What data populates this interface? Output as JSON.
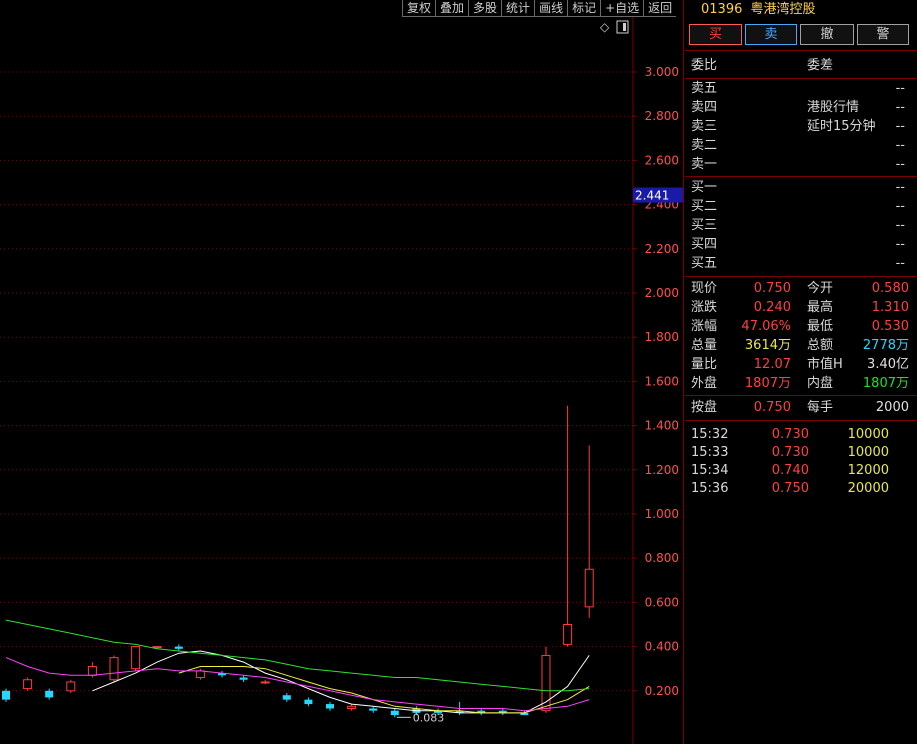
{
  "toolbar": [
    "复权",
    "叠加",
    "多股",
    "统计",
    "画线",
    "标记",
    "+自选",
    "返回"
  ],
  "chart": {
    "price_labels": [
      "3.000",
      "2.800",
      "2.600",
      "2.400",
      "2.200",
      "2.000",
      "1.800",
      "1.600",
      "1.400",
      "1.200",
      "1.000",
      "0.800",
      "0.600",
      "0.400",
      "0.200"
    ],
    "current_price_tag": "2.441",
    "low_marker": "0.083",
    "colors": {
      "grid": "#7a0000",
      "up": "#ff3b3b",
      "down": "#22d8ff",
      "ma_white": "#ffffff",
      "ma_yellow": "#f0f040",
      "ma_magenta": "#ff40ff",
      "ma_green": "#30e030"
    }
  },
  "chart_data": {
    "type": "candlestick",
    "ylim": [
      0.0,
      3.15
    ],
    "candles": [
      {
        "o": 0.2,
        "c": 0.16,
        "h": 0.21,
        "l": 0.15
      },
      {
        "o": 0.21,
        "c": 0.25,
        "h": 0.26,
        "l": 0.2
      },
      {
        "o": 0.2,
        "c": 0.17,
        "h": 0.21,
        "l": 0.16
      },
      {
        "o": 0.2,
        "c": 0.24,
        "h": 0.25,
        "l": 0.19
      },
      {
        "o": 0.27,
        "c": 0.31,
        "h": 0.33,
        "l": 0.26
      },
      {
        "o": 0.25,
        "c": 0.35,
        "h": 0.36,
        "l": 0.24
      },
      {
        "o": 0.3,
        "c": 0.4,
        "h": 0.4,
        "l": 0.29
      },
      {
        "o": 0.4,
        "c": 0.4,
        "h": 0.4,
        "l": 0.39
      },
      {
        "o": 0.4,
        "c": 0.39,
        "h": 0.41,
        "l": 0.38
      },
      {
        "o": 0.26,
        "c": 0.29,
        "h": 0.3,
        "l": 0.25
      },
      {
        "o": 0.28,
        "c": 0.27,
        "h": 0.29,
        "l": 0.26
      },
      {
        "o": 0.26,
        "c": 0.25,
        "h": 0.27,
        "l": 0.24
      },
      {
        "o": 0.24,
        "c": 0.24,
        "h": 0.25,
        "l": 0.23
      },
      {
        "o": 0.18,
        "c": 0.16,
        "h": 0.19,
        "l": 0.15
      },
      {
        "o": 0.16,
        "c": 0.14,
        "h": 0.17,
        "l": 0.13
      },
      {
        "o": 0.14,
        "c": 0.12,
        "h": 0.15,
        "l": 0.11
      },
      {
        "o": 0.12,
        "c": 0.13,
        "h": 0.14,
        "l": 0.11
      },
      {
        "o": 0.12,
        "c": 0.11,
        "h": 0.13,
        "l": 0.1
      },
      {
        "o": 0.11,
        "c": 0.09,
        "h": 0.12,
        "l": 0.08
      },
      {
        "o": 0.12,
        "c": 0.1,
        "h": 0.13,
        "l": 0.09
      },
      {
        "o": 0.11,
        "c": 0.1,
        "h": 0.12,
        "l": 0.09
      },
      {
        "o": 0.11,
        "c": 0.1,
        "h": 0.15,
        "l": 0.09
      },
      {
        "o": 0.11,
        "c": 0.1,
        "h": 0.12,
        "l": 0.09
      },
      {
        "o": 0.11,
        "c": 0.1,
        "h": 0.12,
        "l": 0.09
      },
      {
        "o": 0.1,
        "c": 0.09,
        "h": 0.11,
        "l": 0.09
      },
      {
        "o": 0.11,
        "c": 0.36,
        "h": 0.4,
        "l": 0.1
      },
      {
        "o": 0.41,
        "c": 0.5,
        "h": 1.49,
        "l": 0.4
      },
      {
        "o": 0.58,
        "c": 0.75,
        "h": 1.31,
        "l": 0.53
      }
    ],
    "series": [
      {
        "color": "#ffffff",
        "values": [
          null,
          null,
          null,
          null,
          0.2,
          0.24,
          0.28,
          0.33,
          0.37,
          0.38,
          0.36,
          0.33,
          0.28,
          0.25,
          0.21,
          0.17,
          0.14,
          0.13,
          0.12,
          0.11,
          0.11,
          0.1,
          0.1,
          0.1,
          0.1,
          0.15,
          0.22,
          0.36
        ]
      },
      {
        "color": "#f0f040",
        "values": [
          null,
          null,
          null,
          null,
          null,
          null,
          null,
          null,
          0.28,
          0.31,
          0.31,
          0.31,
          0.3,
          0.27,
          0.24,
          0.21,
          0.19,
          0.16,
          0.13,
          0.12,
          0.11,
          0.11,
          0.1,
          0.1,
          0.1,
          0.13,
          0.16,
          0.22
        ]
      },
      {
        "color": "#ff40ff",
        "values": [
          0.35,
          0.31,
          0.28,
          0.27,
          0.27,
          0.28,
          0.29,
          0.3,
          0.29,
          0.29,
          0.28,
          0.27,
          0.26,
          0.24,
          0.22,
          0.2,
          0.18,
          0.16,
          0.15,
          0.14,
          0.13,
          0.12,
          0.12,
          0.12,
          0.11,
          0.12,
          0.13,
          0.16
        ]
      },
      {
        "color": "#30e030",
        "values": [
          0.52,
          0.5,
          0.48,
          0.46,
          0.44,
          0.42,
          0.41,
          0.39,
          0.38,
          0.37,
          0.36,
          0.35,
          0.34,
          0.32,
          0.3,
          0.29,
          0.28,
          0.27,
          0.26,
          0.26,
          0.25,
          0.24,
          0.23,
          0.22,
          0.21,
          0.2,
          0.2,
          0.21
        ]
      }
    ]
  },
  "panel": {
    "code": "01396",
    "name": "粤港湾控股",
    "buttons": {
      "buy": "买",
      "sell": "卖",
      "cancel": "撤",
      "alert": "警"
    },
    "weibi_label": "委比",
    "weicha_label": "委差",
    "sell_levels": [
      {
        "label": "卖五",
        "value": "--"
      },
      {
        "label": "卖四",
        "value": "--"
      },
      {
        "label": "卖三",
        "value": "--"
      },
      {
        "label": "卖二",
        "value": "--"
      },
      {
        "label": "卖一",
        "value": "--"
      }
    ],
    "sell_notes": [
      "港股行情",
      "延时15分钟"
    ],
    "buy_levels": [
      {
        "label": "买一",
        "value": "--"
      },
      {
        "label": "买二",
        "value": "--"
      },
      {
        "label": "买三",
        "value": "--"
      },
      {
        "label": "买四",
        "value": "--"
      },
      {
        "label": "买五",
        "value": "--"
      }
    ],
    "quote": {
      "xianjia_l": "现价",
      "xianjia_v": "0.750",
      "jinkai_l": "今开",
      "jinkai_v": "0.580",
      "zhangdie_l": "涨跌",
      "zhangdie_v": "0.240",
      "zuigao_l": "最高",
      "zuigao_v": "1.310",
      "zhangfu_l": "涨幅",
      "zhangfu_v": "47.06%",
      "zuidi_l": "最低",
      "zuidi_v": "0.530",
      "zongliang_l": "总量",
      "zongliang_v": "3614万",
      "zonge_l": "总额",
      "zonge_v": "2778万",
      "liangbi_l": "量比",
      "liangbi_v": "12.07",
      "shizhi_l": "市值H",
      "shizhi_v": "3.40亿",
      "waipan_l": "外盘",
      "waipan_v": "1807万",
      "neipan_l": "内盘",
      "neipan_v": "1807万"
    },
    "anpan_l": "按盘",
    "anpan_v": "0.750",
    "meishou_l": "每手",
    "meishou_v": "2000",
    "ticks": [
      {
        "time": "15:32",
        "price": "0.730",
        "vol": "10000"
      },
      {
        "time": "15:33",
        "price": "0.730",
        "vol": "10000"
      },
      {
        "time": "15:34",
        "price": "0.740",
        "vol": "12000"
      },
      {
        "time": "15:36",
        "price": "0.750",
        "vol": "20000"
      }
    ]
  }
}
